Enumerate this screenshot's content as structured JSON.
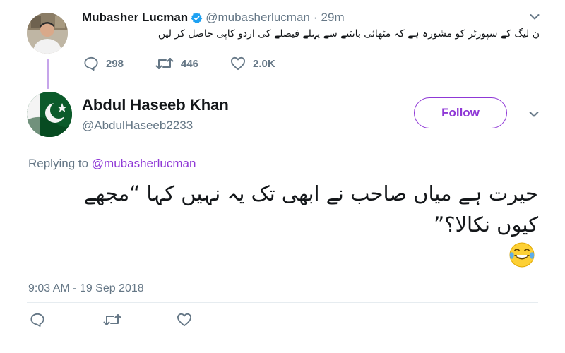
{
  "parent_tweet": {
    "author_name": "Mubasher Lucman",
    "handle": "@mubasherlucman",
    "separator": "·",
    "time": "29m",
    "text": "ن لیگ کے سپورٹر کو مشورہ ہے کہ مٹھائی بانٹنے سے پہلے فیصلے کی اردو کاپی حاصل کر لیں",
    "reply_count": "298",
    "retweet_count": "446",
    "like_count": "2.0K"
  },
  "main_tweet": {
    "author_name": "Abdul Haseeb Khan",
    "handle": "@AbdulHaseeb2233",
    "follow_label": "Follow",
    "replying_prefix": "Replying to",
    "replying_handle": "@mubasherlucman",
    "text": "حیرت ہے میاں صاحب نے ابھی تک یہ نہیں کہا “مجھے کیوں نکالا؟”",
    "timestamp": "9:03 AM - 19 Sep 2018"
  },
  "colors": {
    "accent": "#8f38d6",
    "muted": "#657786",
    "verified": "#1da1f2",
    "thread_line": "#c6a5ea"
  },
  "icons": {
    "reply": "reply-icon",
    "retweet": "retweet-icon",
    "like": "heart-icon",
    "more": "chevron-down-icon",
    "verified": "verified-badge-icon",
    "emoji": "face-with-tears-of-joy-emoji"
  }
}
